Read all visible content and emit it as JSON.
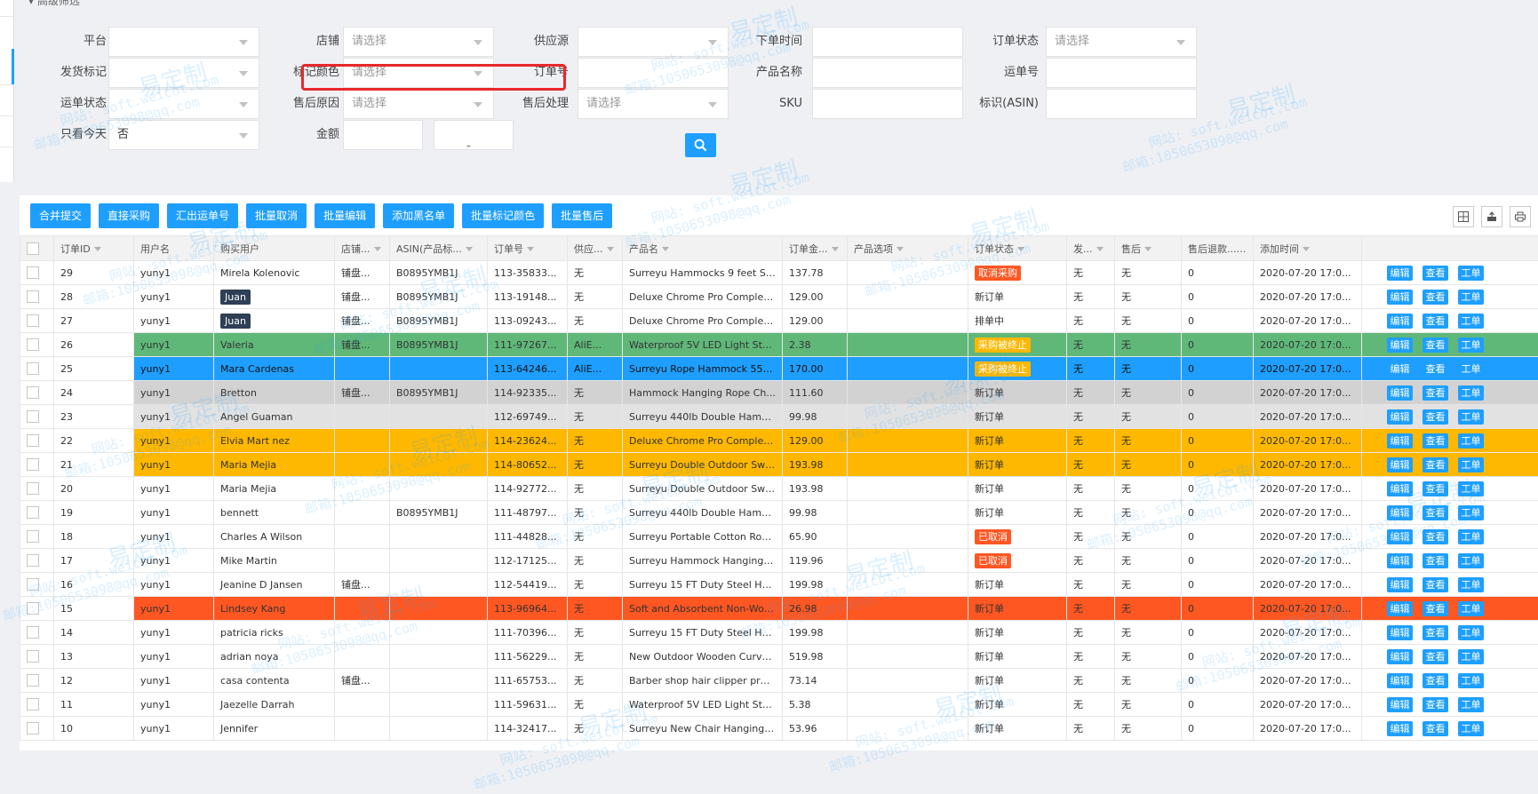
{
  "filter": {
    "header_label": "高级筛选",
    "fields": [
      {
        "label": "平台",
        "value": "",
        "select": true
      },
      {
        "label": "店铺",
        "value": "请选择",
        "select": true
      },
      {
        "label": "供应源",
        "value": "",
        "select": true
      },
      {
        "label": "下单时间",
        "value": "",
        "select": false
      },
      {
        "label": "订单状态",
        "value": "请选择",
        "select": true
      },
      {
        "label": "发货标记",
        "value": "",
        "select": true
      },
      {
        "label": "标记颜色",
        "value": "请选择",
        "select": true
      },
      {
        "label": "订单号",
        "value": "",
        "select": false
      },
      {
        "label": "产品名称",
        "value": "",
        "select": false
      },
      {
        "label": "运单号",
        "value": "",
        "select": false
      },
      {
        "label": "运单状态",
        "value": "",
        "select": true
      },
      {
        "label": "售后原因",
        "value": "请选择",
        "select": true
      },
      {
        "label": "售后处理",
        "value": "请选择",
        "select": true
      },
      {
        "label": "SKU",
        "value": "",
        "select": false
      },
      {
        "label": "标识(ASIN)",
        "value": "",
        "select": false
      },
      {
        "label": "只看今天",
        "value": "否",
        "select": true
      },
      {
        "label": "金额",
        "value": "",
        "select": false
      }
    ],
    "amount_dash": "-",
    "search_icon": "search-icon"
  },
  "toolbar": {
    "buttons": [
      "合并提交",
      "直接采购",
      "汇出运单号",
      "批量取消",
      "批量编辑",
      "添加黑名单",
      "批量标记颜色",
      "批量售后"
    ],
    "icons": [
      "columns-icon",
      "export-icon",
      "print-icon"
    ]
  },
  "table": {
    "headers": [
      "订单ID",
      "用户名",
      "购买用户",
      "店铺...",
      "ASIN(产品标...",
      "订单号",
      "供应...",
      "产品名",
      "订单金...",
      "产品选项",
      "订单状态",
      "发...",
      "售后",
      "售后退款...",
      "添加时间"
    ],
    "op_labels": [
      "编辑",
      "查看",
      "工单"
    ],
    "rows": [
      {
        "id": "29",
        "user": "yuny1",
        "buyer": "Mirela Kolenovic",
        "shop": "铺盘...",
        "asin": "B0895YMB1J",
        "order": "113-35833...",
        "supplier": "无",
        "product": "Surreyu Hammocks 9 feet Sp...",
        "amount": "137.78",
        "option": "",
        "status": "取消采购",
        "status_tag": "red",
        "ship": "无",
        "after": "无",
        "refund": "0",
        "time": "2020-07-20 17:0...",
        "color": ""
      },
      {
        "id": "28",
        "user": "yuny1",
        "buyer": "Juan",
        "buyer_tag": true,
        "shop": "铺盘...",
        "asin": "B0895YMB1J",
        "order": "113-19148...",
        "supplier": "无",
        "product": "Deluxe Chrome Pro Complet...",
        "amount": "129.00",
        "option": "",
        "status": "新订单",
        "status_tag": "",
        "ship": "无",
        "after": "无",
        "refund": "0",
        "time": "2020-07-20 17:0...",
        "color": ""
      },
      {
        "id": "27",
        "user": "yuny1",
        "buyer": "Juan",
        "buyer_tag": true,
        "shop": "铺盘...",
        "asin": "B0895YMB1J",
        "order": "113-09243...",
        "supplier": "无",
        "product": "Deluxe Chrome Pro Complet...",
        "amount": "129.00",
        "option": "",
        "status": "排单中",
        "status_tag": "",
        "ship": "无",
        "after": "无",
        "refund": "0",
        "time": "2020-07-20 17:0...",
        "color": ""
      },
      {
        "id": "26",
        "user": "yuny1",
        "buyer": "Valeria",
        "shop": "铺盘...",
        "asin": "B0895YMB1J",
        "order": "111-97267...",
        "supplier": "AliE...",
        "product": "Waterproof 5V LED Light Stri...",
        "amount": "2.38",
        "option": "",
        "status": "采购被终止",
        "status_tag": "orange",
        "ship": "无",
        "after": "无",
        "refund": "0",
        "time": "2020-07-20 17:0...",
        "color": "green"
      },
      {
        "id": "25",
        "user": "yuny1",
        "buyer": "Mara Cardenas",
        "shop": "",
        "asin": "",
        "order": "113-64246...",
        "supplier": "AliE...",
        "product": "Surreyu Rope Hammock 55\" ...",
        "amount": "170.00",
        "option": "",
        "status": "采购被终止",
        "status_tag": "orange",
        "ship": "无",
        "after": "无",
        "refund": "0",
        "time": "2020-07-20 17:0...",
        "color": "blue"
      },
      {
        "id": "24",
        "user": "yuny1",
        "buyer": "Bretton",
        "shop": "铺盘...",
        "asin": "B0895YMB1J",
        "order": "114-92335...",
        "supplier": "无",
        "product": "Hammock Hanging Rope Ch...",
        "amount": "111.60",
        "option": "",
        "status": "新订单",
        "status_tag": "",
        "ship": "无",
        "after": "无",
        "refund": "0",
        "time": "2020-07-20 17:0...",
        "color": "gray"
      },
      {
        "id": "23",
        "user": "yuny1",
        "buyer": "Angel Guaman",
        "shop": "",
        "asin": "",
        "order": "112-69749...",
        "supplier": "无",
        "product": "Surreyu 440lb Double Hamm...",
        "amount": "99.98",
        "option": "",
        "status": "新订单",
        "status_tag": "",
        "ship": "无",
        "after": "无",
        "refund": "0",
        "time": "2020-07-20 17:0...",
        "color": "light"
      },
      {
        "id": "22",
        "user": "yuny1",
        "buyer": "Elvia Mart nez",
        "shop": "",
        "asin": "",
        "order": "114-23624...",
        "supplier": "无",
        "product": "Deluxe Chrome Pro Complet...",
        "amount": "129.00",
        "option": "",
        "status": "新订单",
        "status_tag": "",
        "ship": "无",
        "after": "无",
        "refund": "0",
        "time": "2020-07-20 17:0...",
        "color": "orange"
      },
      {
        "id": "21",
        "user": "yuny1",
        "buyer": "Maria Mejia",
        "shop": "",
        "asin": "",
        "order": "114-80652...",
        "supplier": "无",
        "product": "Surreyu Double Outdoor Swi...",
        "amount": "193.98",
        "option": "",
        "status": "新订单",
        "status_tag": "",
        "ship": "无",
        "after": "无",
        "refund": "0",
        "time": "2020-07-20 17:0...",
        "color": "orange"
      },
      {
        "id": "20",
        "user": "yuny1",
        "buyer": "Maria Mejia",
        "shop": "",
        "asin": "",
        "order": "114-92772...",
        "supplier": "无",
        "product": "Surreyu Double Outdoor Swi...",
        "amount": "193.98",
        "option": "",
        "status": "新订单",
        "status_tag": "",
        "ship": "无",
        "after": "无",
        "refund": "0",
        "time": "2020-07-20 17:0...",
        "color": ""
      },
      {
        "id": "19",
        "user": "yuny1",
        "buyer": "bennett",
        "shop": "",
        "asin": "B0895YMB1J",
        "order": "111-48797...",
        "supplier": "无",
        "product": "Surreyu 440lb Double Hamm...",
        "amount": "99.98",
        "option": "",
        "status": "新订单",
        "status_tag": "",
        "ship": "无",
        "after": "无",
        "refund": "0",
        "time": "2020-07-20 17:0...",
        "color": ""
      },
      {
        "id": "18",
        "user": "yuny1",
        "buyer": "Charles A Wilson",
        "shop": "",
        "asin": "",
        "order": "111-44828...",
        "supplier": "无",
        "product": "Surreyu Portable Cotton Rop...",
        "amount": "65.90",
        "option": "",
        "status": "已取消",
        "status_tag": "red",
        "ship": "无",
        "after": "无",
        "refund": "0",
        "time": "2020-07-20 17:0...",
        "color": ""
      },
      {
        "id": "17",
        "user": "yuny1",
        "buyer": "Mike Martin",
        "shop": "",
        "asin": "",
        "order": "112-17125...",
        "supplier": "无",
        "product": "Surreyu Hammock Hanging ...",
        "amount": "119.96",
        "option": "",
        "status": "已取消",
        "status_tag": "red",
        "ship": "无",
        "after": "无",
        "refund": "0",
        "time": "2020-07-20 17:0...",
        "color": ""
      },
      {
        "id": "16",
        "user": "yuny1",
        "buyer": "Jeanine D Jansen",
        "shop": "铺盘...",
        "asin": "",
        "order": "112-54419...",
        "supplier": "无",
        "product": "Surreyu 15 FT Duty Steel Ha...",
        "amount": "199.98",
        "option": "",
        "status": "新订单",
        "status_tag": "",
        "ship": "无",
        "after": "无",
        "refund": "0",
        "time": "2020-07-20 17:0...",
        "color": ""
      },
      {
        "id": "15",
        "user": "yuny1",
        "buyer": "Lindsey Kang",
        "shop": "",
        "asin": "",
        "order": "113-96964...",
        "supplier": "无",
        "product": "Soft and Absorbent Non-Wov...",
        "amount": "26.98",
        "option": "",
        "status": "新订单",
        "status_tag": "",
        "ship": "无",
        "after": "无",
        "refund": "0",
        "time": "2020-07-20 17:0...",
        "color": "red"
      },
      {
        "id": "14",
        "user": "yuny1",
        "buyer": "patricia ricks",
        "shop": "",
        "asin": "",
        "order": "111-70396...",
        "supplier": "无",
        "product": "Surreyu 15 FT Duty Steel Ha...",
        "amount": "199.98",
        "option": "",
        "status": "新订单",
        "status_tag": "",
        "ship": "无",
        "after": "无",
        "refund": "0",
        "time": "2020-07-20 17:0...",
        "color": ""
      },
      {
        "id": "13",
        "user": "yuny1",
        "buyer": "adrian noya",
        "shop": "",
        "asin": "",
        "order": "111-56229...",
        "supplier": "无",
        "product": "New Outdoor Wooden Curve...",
        "amount": "519.98",
        "option": "",
        "status": "新订单",
        "status_tag": "",
        "ship": "无",
        "after": "无",
        "refund": "0",
        "time": "2020-07-20 17:0...",
        "color": ""
      },
      {
        "id": "12",
        "user": "yuny1",
        "buyer": "casa contenta",
        "shop": "铺盘...",
        "asin": "",
        "order": "111-65753...",
        "supplier": "无",
        "product": "Barber shop hair clipper profe...",
        "amount": "73.14",
        "option": "",
        "status": "新订单",
        "status_tag": "",
        "ship": "无",
        "after": "无",
        "refund": "0",
        "time": "2020-07-20 17:0...",
        "color": ""
      },
      {
        "id": "11",
        "user": "yuny1",
        "buyer": "Jaezelle Darrah",
        "shop": "",
        "asin": "",
        "order": "111-59631...",
        "supplier": "无",
        "product": "Waterproof 5V LED Light Stri...",
        "amount": "5.38",
        "option": "",
        "status": "新订单",
        "status_tag": "",
        "ship": "无",
        "after": "无",
        "refund": "0",
        "time": "2020-07-20 17:0...",
        "color": ""
      },
      {
        "id": "10",
        "user": "yuny1",
        "buyer": "Jennifer",
        "shop": "",
        "asin": "",
        "order": "114-32417...",
        "supplier": "无",
        "product": "Surreyu New Chair Hanging ...",
        "amount": "53.96",
        "option": "",
        "status": "新订单",
        "status_tag": "",
        "ship": "无",
        "after": "无",
        "refund": "0",
        "time": "2020-07-20 17:0...",
        "color": ""
      }
    ]
  },
  "watermark": {
    "brand": "易定制",
    "site": "网站: soft.weicot.com",
    "email": "邮箱:1050653098@qq.com"
  }
}
